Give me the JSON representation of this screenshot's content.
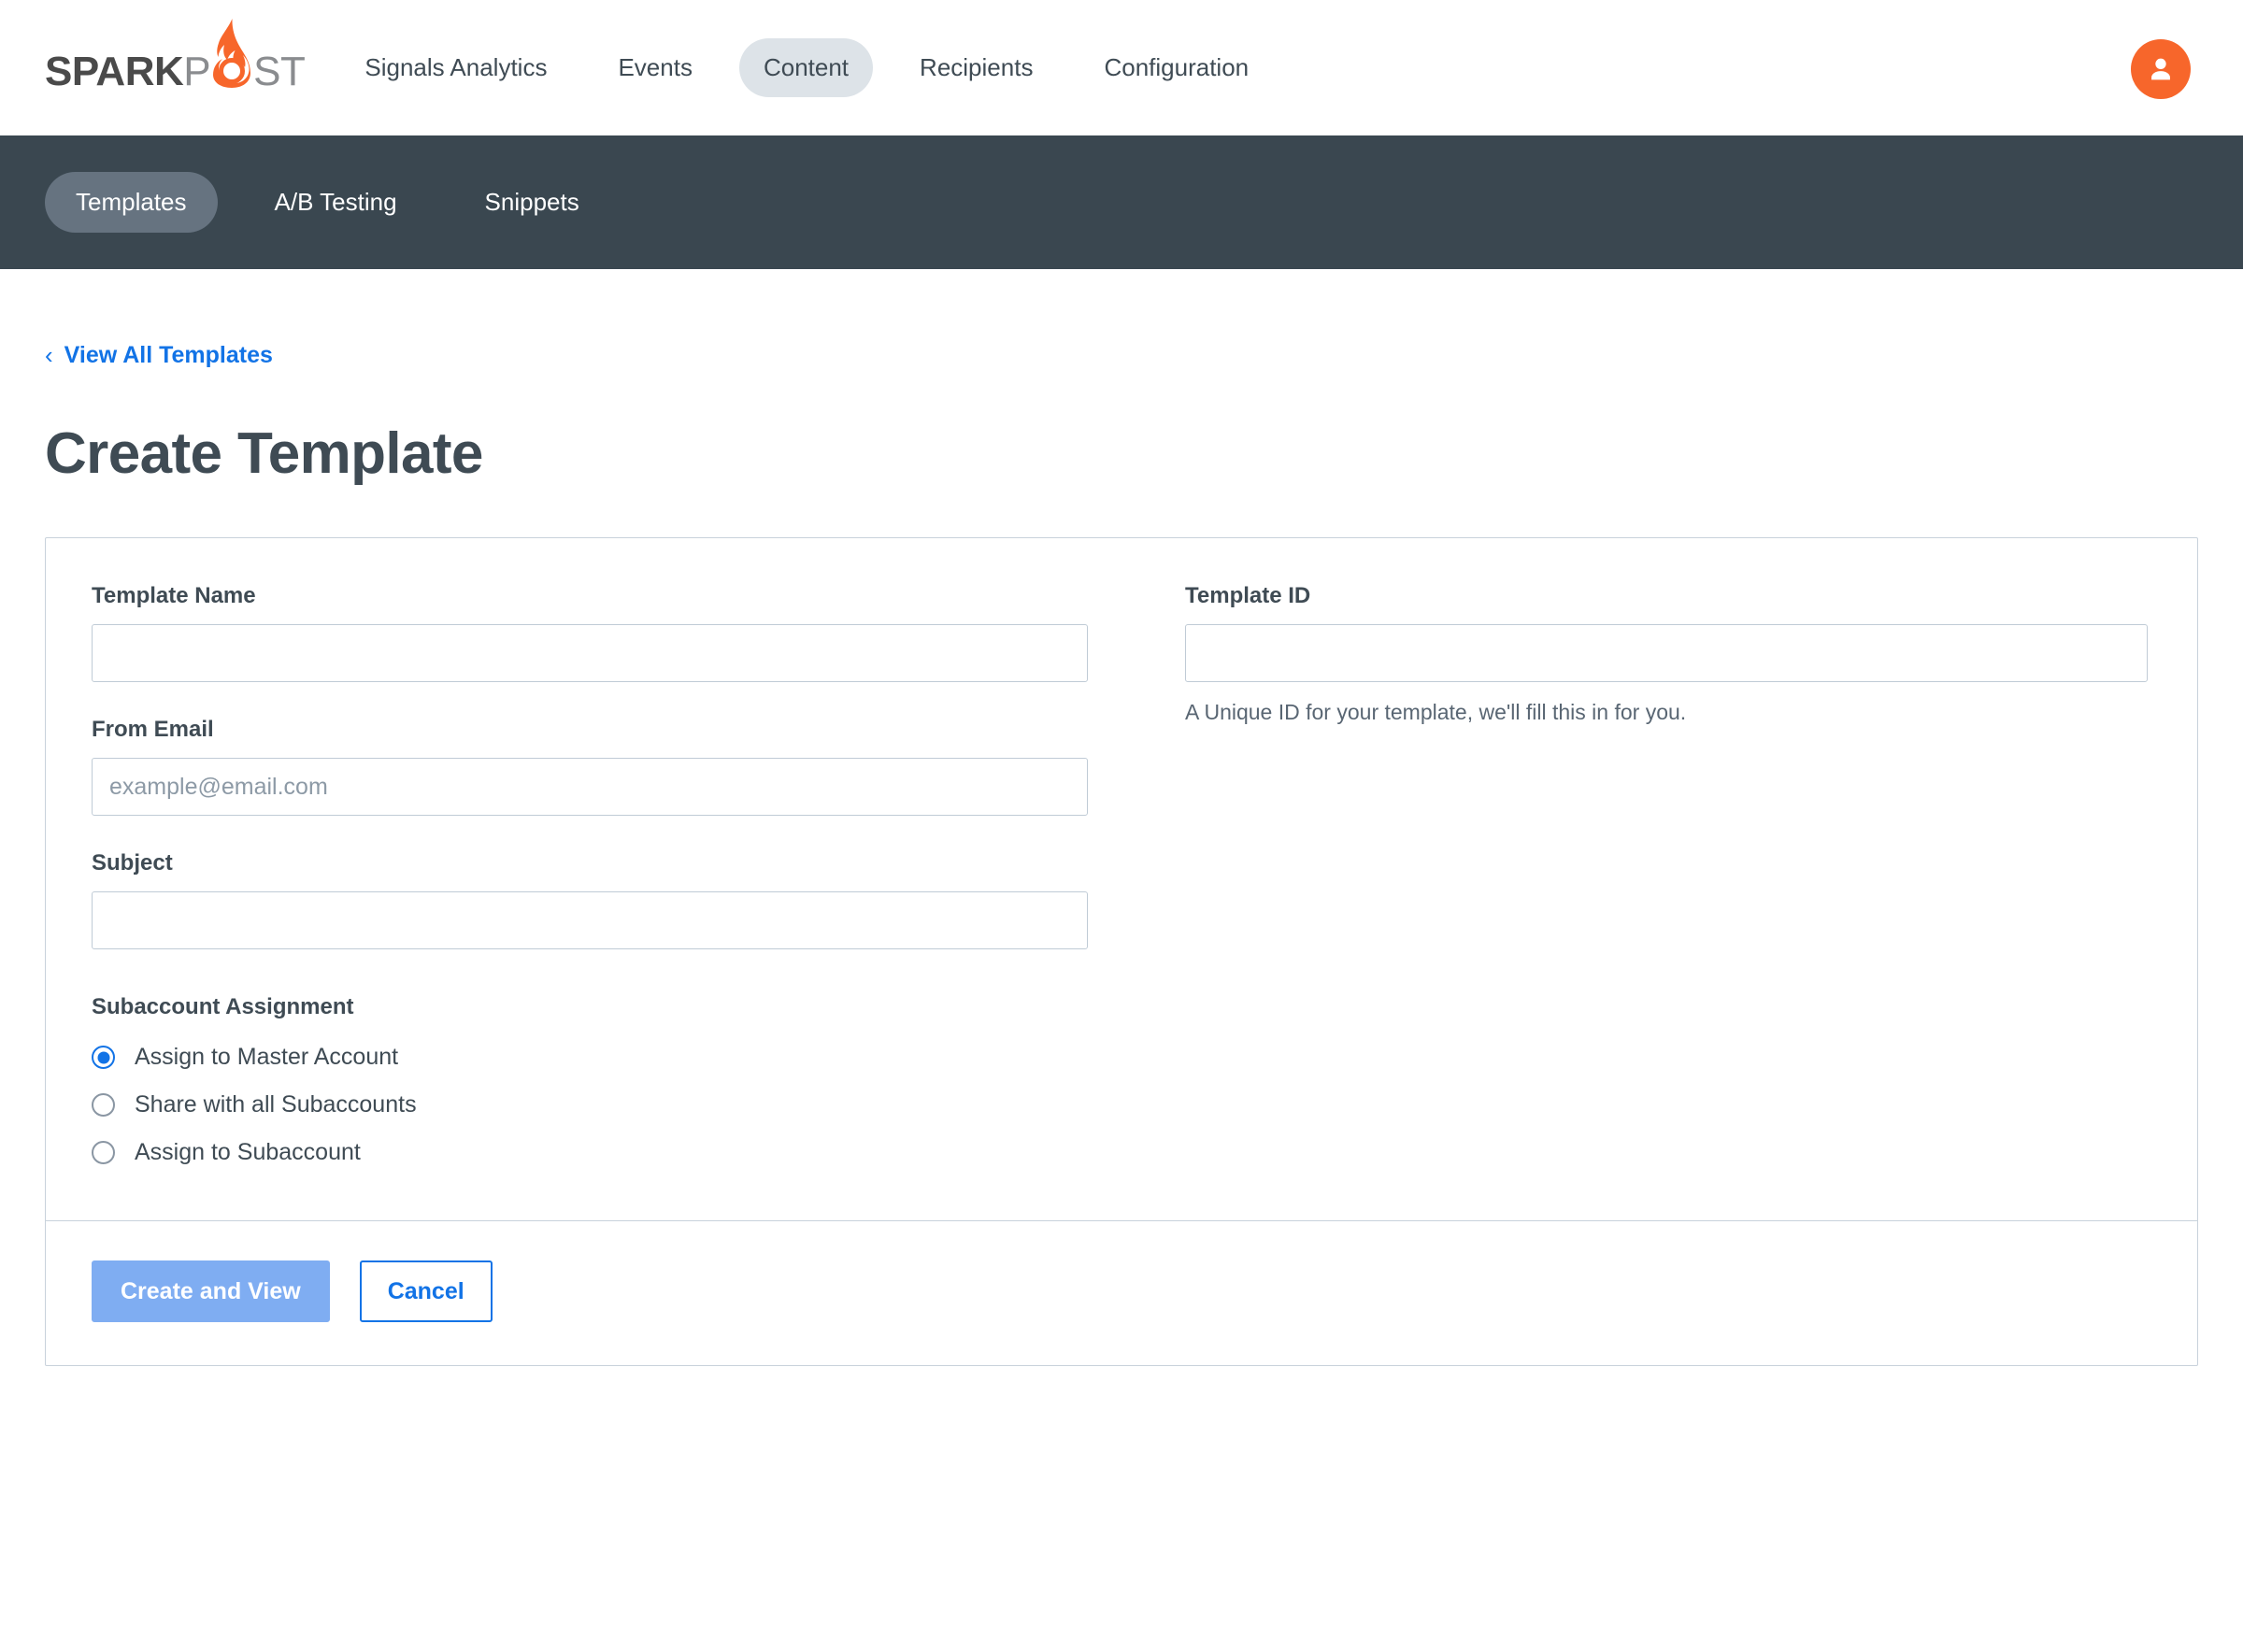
{
  "header": {
    "logo": {
      "part1": "SPARK",
      "part2": "P",
      "part3": "ST",
      "flame_icon": "flame-icon",
      "brand_color": "#f7662b"
    },
    "nav": [
      {
        "label": "Signals Analytics",
        "active": false
      },
      {
        "label": "Events",
        "active": false
      },
      {
        "label": "Content",
        "active": true
      },
      {
        "label": "Recipients",
        "active": false
      },
      {
        "label": "Configuration",
        "active": false
      }
    ],
    "avatar_icon": "user-avatar-icon"
  },
  "subnav": {
    "tabs": [
      {
        "label": "Templates",
        "active": true
      },
      {
        "label": "A/B Testing",
        "active": false
      },
      {
        "label": "Snippets",
        "active": false
      }
    ],
    "background_color": "#3a4750",
    "active_pill_color": "#667380"
  },
  "breadcrumb": {
    "chevron": "‹",
    "label": "View All Templates",
    "link_color": "#1273e6"
  },
  "page": {
    "title": "Create Template"
  },
  "form": {
    "template_name": {
      "label": "Template Name",
      "value": "",
      "placeholder": ""
    },
    "template_id": {
      "label": "Template ID",
      "value": "",
      "placeholder": "",
      "help": "A Unique ID for your template, we'll fill this in for you."
    },
    "from_email": {
      "label": "From Email",
      "value": "",
      "placeholder": "example@email.com"
    },
    "subject": {
      "label": "Subject",
      "value": "",
      "placeholder": ""
    },
    "subaccount": {
      "label": "Subaccount Assignment",
      "options": [
        {
          "label": "Assign to Master Account",
          "selected": true
        },
        {
          "label": "Share with all Subaccounts",
          "selected": false
        },
        {
          "label": "Assign to Subaccount",
          "selected": false
        }
      ]
    }
  },
  "footer": {
    "primary_label": "Create and View",
    "secondary_label": "Cancel",
    "primary_color": "#7fadf2",
    "secondary_color": "#1273e6"
  }
}
